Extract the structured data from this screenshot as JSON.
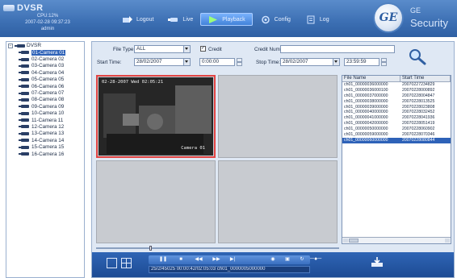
{
  "brand": {
    "title": "DVSR",
    "cpu": "CPU:12%",
    "datetime": "2007-02-28 09:37:23",
    "user": "admin"
  },
  "nav": [
    {
      "label": "Logout",
      "icon": "logout-icon"
    },
    {
      "label": "Live",
      "icon": "live-icon"
    },
    {
      "label": "Playback",
      "icon": "playback-icon"
    },
    {
      "label": "Config",
      "icon": "config-icon"
    },
    {
      "label": "Log",
      "icon": "log-icon"
    }
  ],
  "logo": {
    "mark": "GE",
    "line1": "GE",
    "line2": "Security"
  },
  "tree": {
    "root": "DVSR",
    "cameras": [
      "01-Camera 01",
      "02-Camera 02",
      "03-Camera 03",
      "04-Camera 04",
      "05-Camera 05",
      "06-Camera 06",
      "07-Camera 07",
      "08-Camera 08",
      "09-Camera 09",
      "10-Camera 10",
      "11-Camera 11",
      "12-Camera 12",
      "13-Camera 13",
      "14-Camera 14",
      "15-Camera 15",
      "16-Camera 16"
    ]
  },
  "filters": {
    "file_type_label": "File Type:",
    "file_type_value": "ALL",
    "credit_label": "Credit",
    "credit_checked": "✓",
    "credit_num_label": "Credit Num:",
    "credit_num_value": "",
    "start_time_label": "Start Time:",
    "start_date": "28/02/2007",
    "start_clock": "0:00:00",
    "stop_time_label": "Stop Time:",
    "stop_date": "28/02/2007",
    "stop_clock": "23:59:59"
  },
  "video": {
    "osd_top": "02-28-2007 Wed 02:05:21",
    "osd_camera": "Camera 01"
  },
  "files": {
    "col_name": "File Name",
    "col_start": "Start Time",
    "rows": [
      [
        "ch01_00000036000000",
        "20070227234829"
      ],
      [
        "ch01_00000036000100",
        "20070228000892"
      ],
      [
        "ch01_00000037000000",
        "20070228004847"
      ],
      [
        "ch01_00000038000000",
        "20070228013525"
      ],
      [
        "ch01_00000039000000",
        "20070228023808"
      ],
      [
        "ch01_00000040000000",
        "20070228032452"
      ],
      [
        "ch01_00000041000000",
        "20070228041936"
      ],
      [
        "ch01_00000042000000",
        "20070228051419"
      ],
      [
        "ch01_00000050000000",
        "20070228060902"
      ],
      [
        "ch01_00000059000000",
        "20070228070346"
      ],
      [
        "ch01_00000060000000",
        "20070228080844"
      ]
    ]
  },
  "playback": {
    "status": "25/2/45025 00:00:42/02:05:03 ch01_0000005000000"
  }
}
